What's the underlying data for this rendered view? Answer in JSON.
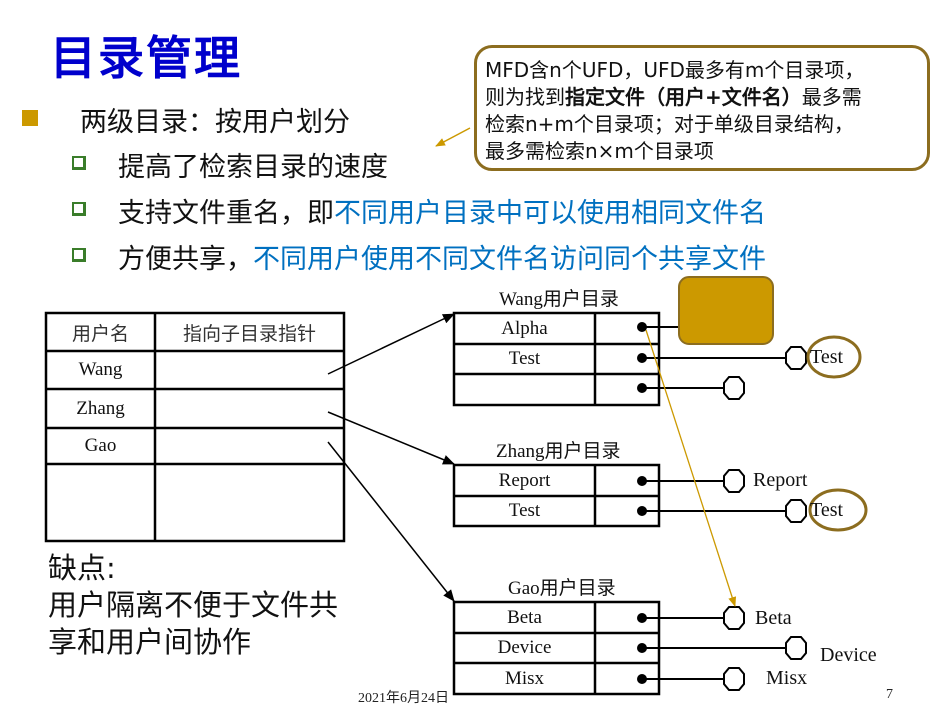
{
  "slide": {
    "title": "目录管理",
    "bullet_main": "两级目录：按用户划分",
    "sub_bullets": [
      {
        "black": "提高了检索目录的速度",
        "blue": ""
      },
      {
        "black": "支持文件重名，即",
        "blue": "不同用户目录中可以使用相同文件名"
      },
      {
        "black": "方便共享，",
        "blue": "不同用户使用不同文件名访问同个共享文件"
      }
    ],
    "callout": {
      "line1": "MFD含n个UFD，UFD最多有m个目录项，",
      "line2_pre": "则为找到",
      "line2_bold": "指定文件（用户+文件名）",
      "line2_post": "最多需",
      "line3": "检索n+m个目录项；对于单级目录结构，",
      "line4": "最多需检索n×m个目录项"
    },
    "drawback": {
      "label": "缺点:",
      "line1": "用户隔离不便于文件共",
      "line2": "享和用户间协作"
    },
    "footer": {
      "date": "2021年6月24日",
      "page": "7"
    },
    "colors": {
      "title": "#0000cc",
      "highlight": "#0070c0",
      "accent_gold": "#cc9900",
      "callout_border": "#8c6d1f",
      "sub_bullet": "#3a7d2a"
    }
  },
  "mfd": {
    "headers": [
      "用户名",
      "指向子目录指针"
    ],
    "rows": [
      "Wang",
      "Zhang",
      "Gao",
      ""
    ]
  },
  "ufds": [
    {
      "title": "Wang用户目录",
      "entries": [
        "Alpha",
        "Test",
        ""
      ],
      "files": [
        "",
        "Test",
        ""
      ]
    },
    {
      "title": "Zhang用户目录",
      "entries": [
        "Report",
        "Test"
      ],
      "files": [
        "Report",
        "Test"
      ]
    },
    {
      "title": "Gao用户目录",
      "entries": [
        "Beta",
        "Device",
        "Misx"
      ],
      "files": [
        "Beta",
        "Device",
        "Misx"
      ]
    }
  ]
}
